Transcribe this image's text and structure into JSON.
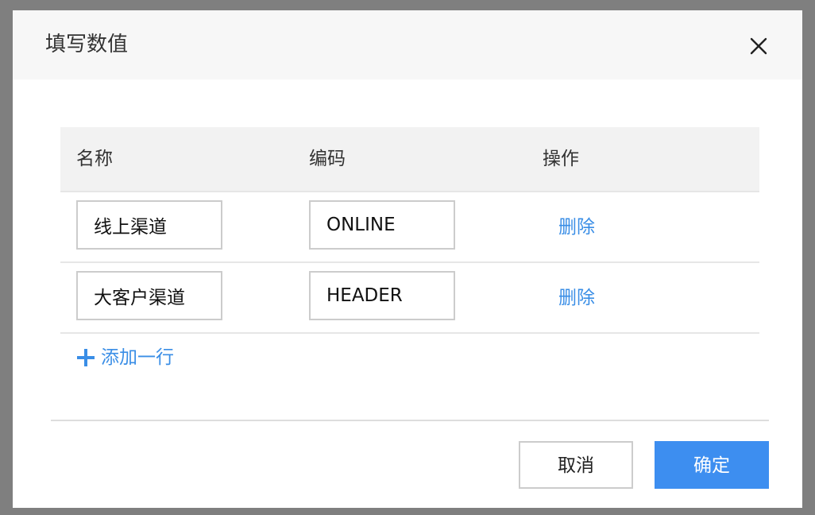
{
  "dialog": {
    "title": "填写数值",
    "close_icon": "close-icon"
  },
  "table": {
    "headers": {
      "name": "名称",
      "code": "编码",
      "action": "操作"
    },
    "rows": [
      {
        "name": "线上渠道",
        "code": "ONLINE",
        "action": "删除"
      },
      {
        "name": "大客户渠道",
        "code": "HEADER",
        "action": "删除"
      }
    ]
  },
  "add_row": {
    "icon": "plus-icon",
    "label": "添加一行"
  },
  "footer": {
    "cancel_label": "取消",
    "ok_label": "确定"
  },
  "colors": {
    "link": "#3a8ee6",
    "primary": "#3d8ef0",
    "header_bg": "#f7f7f7",
    "table_header_bg": "#f2f2f2"
  }
}
